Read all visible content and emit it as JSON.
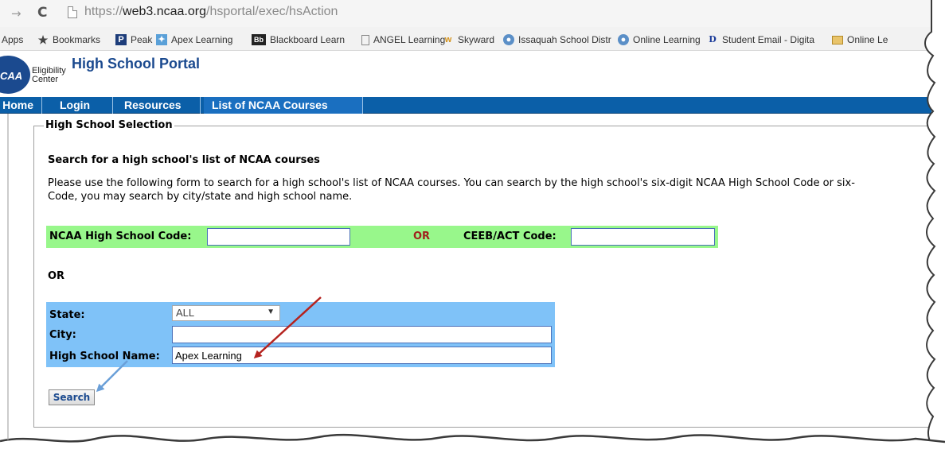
{
  "browser": {
    "url_scheme": "https://",
    "url_host": "web3.ncaa.org",
    "url_path": "/hsportal/exec/hsAction",
    "bookmarks": [
      {
        "label": "Apps",
        "icon": "apps-grid-icon"
      },
      {
        "label": "Bookmarks",
        "icon": "star-icon"
      },
      {
        "label": "Peak",
        "icon": "peak-p-icon"
      },
      {
        "label": "Apex Learning",
        "icon": "apex-learning-icon"
      },
      {
        "label": "Blackboard Learn",
        "icon": "blackboard-icon"
      },
      {
        "label": "ANGEL Learning",
        "icon": "page-icon"
      },
      {
        "label": "Skyward",
        "icon": "skyward-icon"
      },
      {
        "label": "Issaquah School Distr",
        "icon": "globe-icon"
      },
      {
        "label": "Online Learning",
        "icon": "globe-icon"
      },
      {
        "label": "Student Email - Digita",
        "icon": "d-icon"
      },
      {
        "label": "Online Le",
        "icon": "folder-icon"
      }
    ]
  },
  "header": {
    "logo_text": "CAA",
    "eligibility_line1": "Eligibility",
    "eligibility_line2": "Center",
    "portal_title": "High School Portal"
  },
  "nav": {
    "items": [
      "Home",
      "Login",
      "Resources",
      "List of NCAA Courses"
    ],
    "active": "List of NCAA Courses"
  },
  "form": {
    "legend": "High School Selection",
    "title": "Search for a high school's list of NCAA courses",
    "desc_line1": "Please use the following form to search for a high school's list of NCAA courses. You can search by the high school's six-digit NCAA High School Code or six-",
    "desc_line2": "Code, you may search by city/state and high school name.",
    "ncaa_code_label": "NCAA High School Code:",
    "ncaa_code_value": "",
    "or_label": "OR",
    "ceeb_label": "CEEB/ACT Code:",
    "ceeb_value": "",
    "or_label2": "OR",
    "state_label": "State:",
    "state_value": "ALL",
    "city_label": "City:",
    "city_value": "",
    "school_name_label": "High School Name:",
    "school_name_value": "Apex Learning",
    "search_button": "Search"
  },
  "colors": {
    "nav_blue": "#0b5fa8",
    "title_blue": "#1b4a8f",
    "green_row": "#98f78b",
    "blue_box": "#7fc2f8",
    "or_red": "#a0221d",
    "arrow_red": "#b5231f",
    "arrow_blue": "#6a9fd8"
  }
}
